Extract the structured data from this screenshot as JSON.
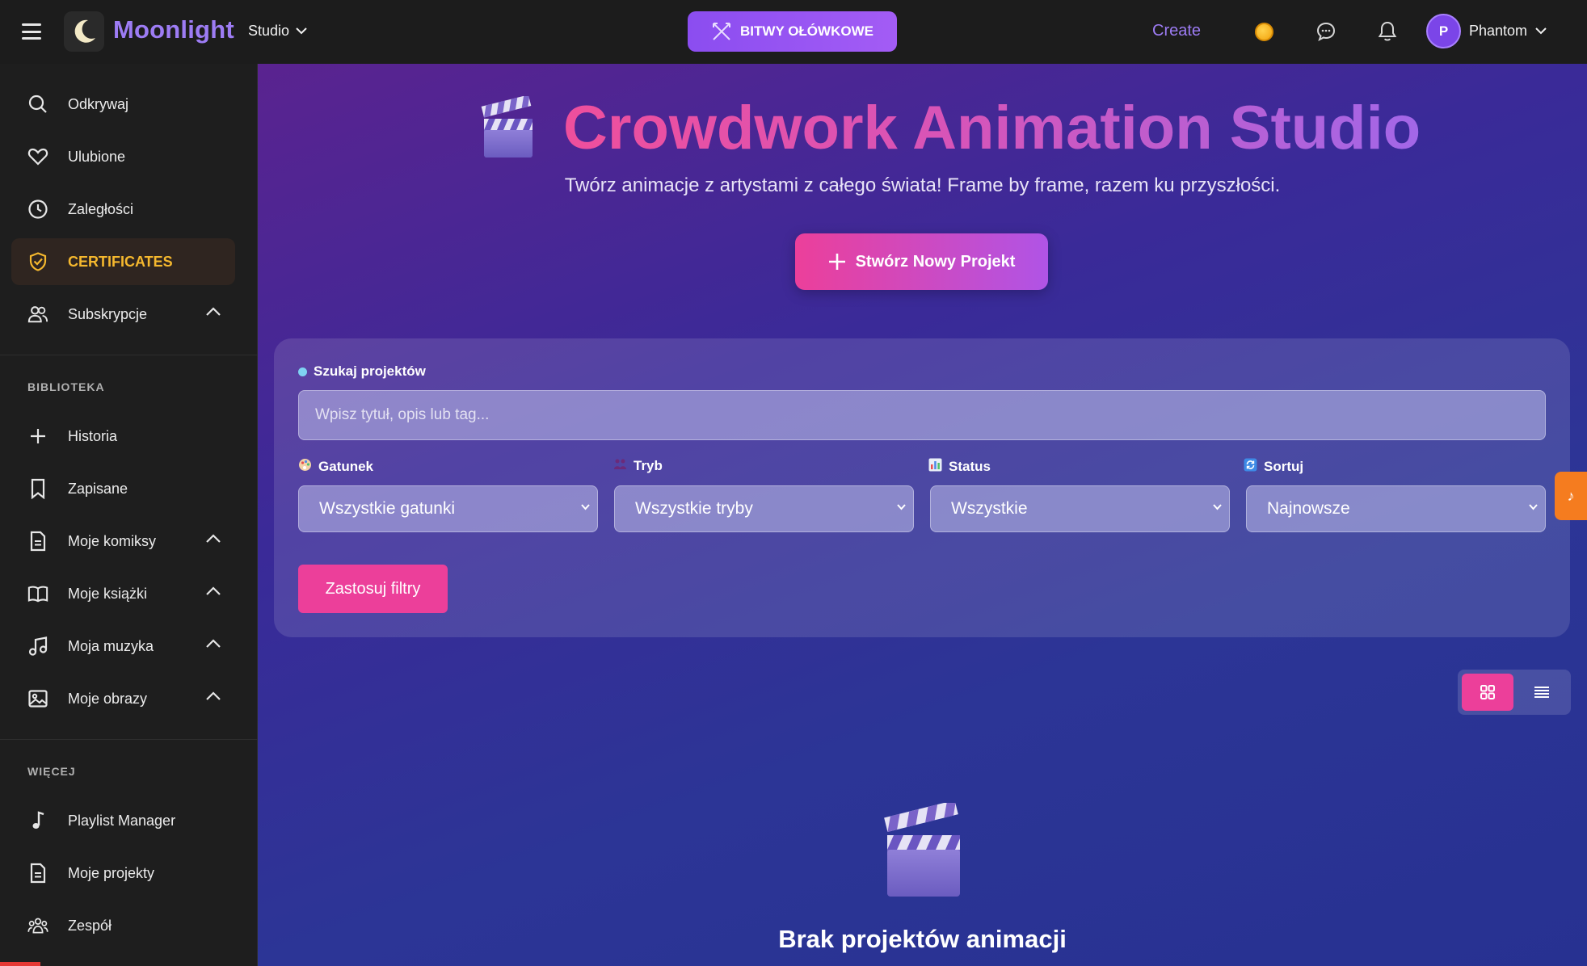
{
  "topbar": {
    "brand": "Moonlight",
    "studio_label": "Studio",
    "battles_label": "BITWY OŁÓWKOWE",
    "create_label": "Create",
    "user_initial": "P",
    "user_name": "Phantom"
  },
  "sidebar": {
    "items": [
      {
        "label": "Odkrywaj",
        "icon": "search-icon"
      },
      {
        "label": "Ulubione",
        "icon": "heart-icon"
      },
      {
        "label": "Zaległości",
        "icon": "clock-icon"
      },
      {
        "label": "CERTIFICATES",
        "icon": "shield-check-icon",
        "active": true
      },
      {
        "label": "Subskrypcje",
        "icon": "users-icon",
        "expandable": true
      }
    ],
    "library_header": "BIBLIOTEKA",
    "library": [
      {
        "label": "Historia",
        "icon": "plus-icon"
      },
      {
        "label": "Zapisane",
        "icon": "bookmark-icon"
      },
      {
        "label": "Moje komiksy",
        "icon": "document-icon",
        "expandable": true
      },
      {
        "label": "Moje książki",
        "icon": "book-icon",
        "expandable": true
      },
      {
        "label": "Moja muzyka",
        "icon": "music-icon",
        "expandable": true
      },
      {
        "label": "Moje obrazy",
        "icon": "image-icon",
        "expandable": true
      }
    ],
    "more_header": "WIĘCEJ",
    "more": [
      {
        "label": "Playlist Manager",
        "icon": "music-note-icon"
      },
      {
        "label": "Moje projekty",
        "icon": "document-icon"
      },
      {
        "label": "Zespół",
        "icon": "team-icon"
      }
    ]
  },
  "hero": {
    "title": "Crowdwork Animation Studio",
    "subtitle": "Twórz animacje z artystami z całego świata! Frame by frame, razem ku przyszłości.",
    "new_project_label": "Stwórz Nowy Projekt"
  },
  "filters": {
    "search_label": "Szukaj projektów",
    "search_placeholder": "Wpisz tytuł, opis lub tag...",
    "genre_label": "Gatunek",
    "genre_value": "Wszystkie gatunki",
    "mode_label": "Tryb",
    "mode_value": "Wszystkie tryby",
    "status_label": "Status",
    "status_value": "Wszystkie",
    "sort_label": "Sortuj",
    "sort_value": "Najnowsze",
    "apply_label": "Zastosuj filtry"
  },
  "side_tab_glyph": "♪",
  "empty_state": {
    "title": "Brak projektów animacji"
  },
  "colors": {
    "accent_purple": "#9d7cf4",
    "accent_pink": "#ec3f9a",
    "active_gold": "#f5b82e",
    "orange_tab": "#f57c1f"
  }
}
